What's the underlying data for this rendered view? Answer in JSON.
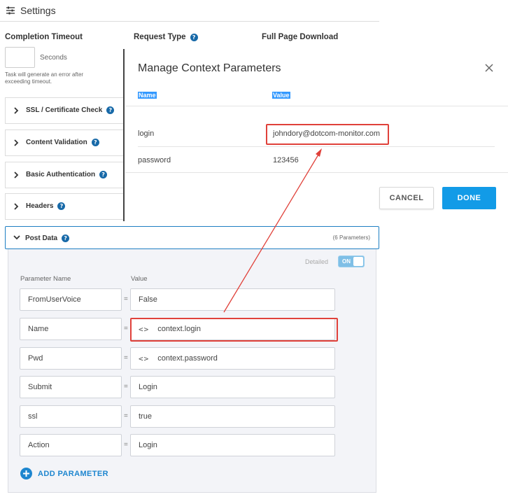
{
  "header": {
    "title": "Settings",
    "icon": "settings-sliders-icon"
  },
  "fields": {
    "completion_timeout_label": "Completion Timeout",
    "request_type_label": "Request Type",
    "full_page_download_label": "Full Page Download",
    "timeout_value": "",
    "seconds_label": "Seconds",
    "timeout_note": "Task will generate an error after exceeding timeout."
  },
  "sections": [
    {
      "label": "SSL / Certificate Check",
      "help": true
    },
    {
      "label": "Content Validation",
      "help": true
    },
    {
      "label": "Basic Authentication",
      "help": true
    },
    {
      "label": "Headers",
      "help": true
    }
  ],
  "modal": {
    "title": "Manage Context Parameters",
    "col_name": "Name",
    "col_value": "Value",
    "rows": [
      {
        "name": "login",
        "value": "johndory@dotcom-monitor.com"
      },
      {
        "name": "password",
        "value": "123456"
      }
    ],
    "cancel_label": "CANCEL",
    "done_label": "DONE"
  },
  "post_data": {
    "label": "Post Data",
    "count": "(6 Parameters)",
    "detailed_label": "Detailed",
    "toggle_label": "ON",
    "toggle_on": true,
    "col_param_name": "Parameter Name",
    "col_value": "Value",
    "params": [
      {
        "name": "FromUserVoice",
        "value": "False",
        "context": false
      },
      {
        "name": "Name",
        "value": "context.login",
        "context": true
      },
      {
        "name": "Pwd",
        "value": "context.password",
        "context": true
      },
      {
        "name": "Submit",
        "value": "Login",
        "context": false
      },
      {
        "name": "ssl",
        "value": "true",
        "context": false
      },
      {
        "name": "Action",
        "value": "Login",
        "context": false
      }
    ],
    "add_label": "ADD PARAMETER"
  },
  "colors": {
    "accent": "#129be7",
    "highlight_red": "#e0413a",
    "help_blue": "#1769a8",
    "selection_blue": "#3399ff"
  }
}
